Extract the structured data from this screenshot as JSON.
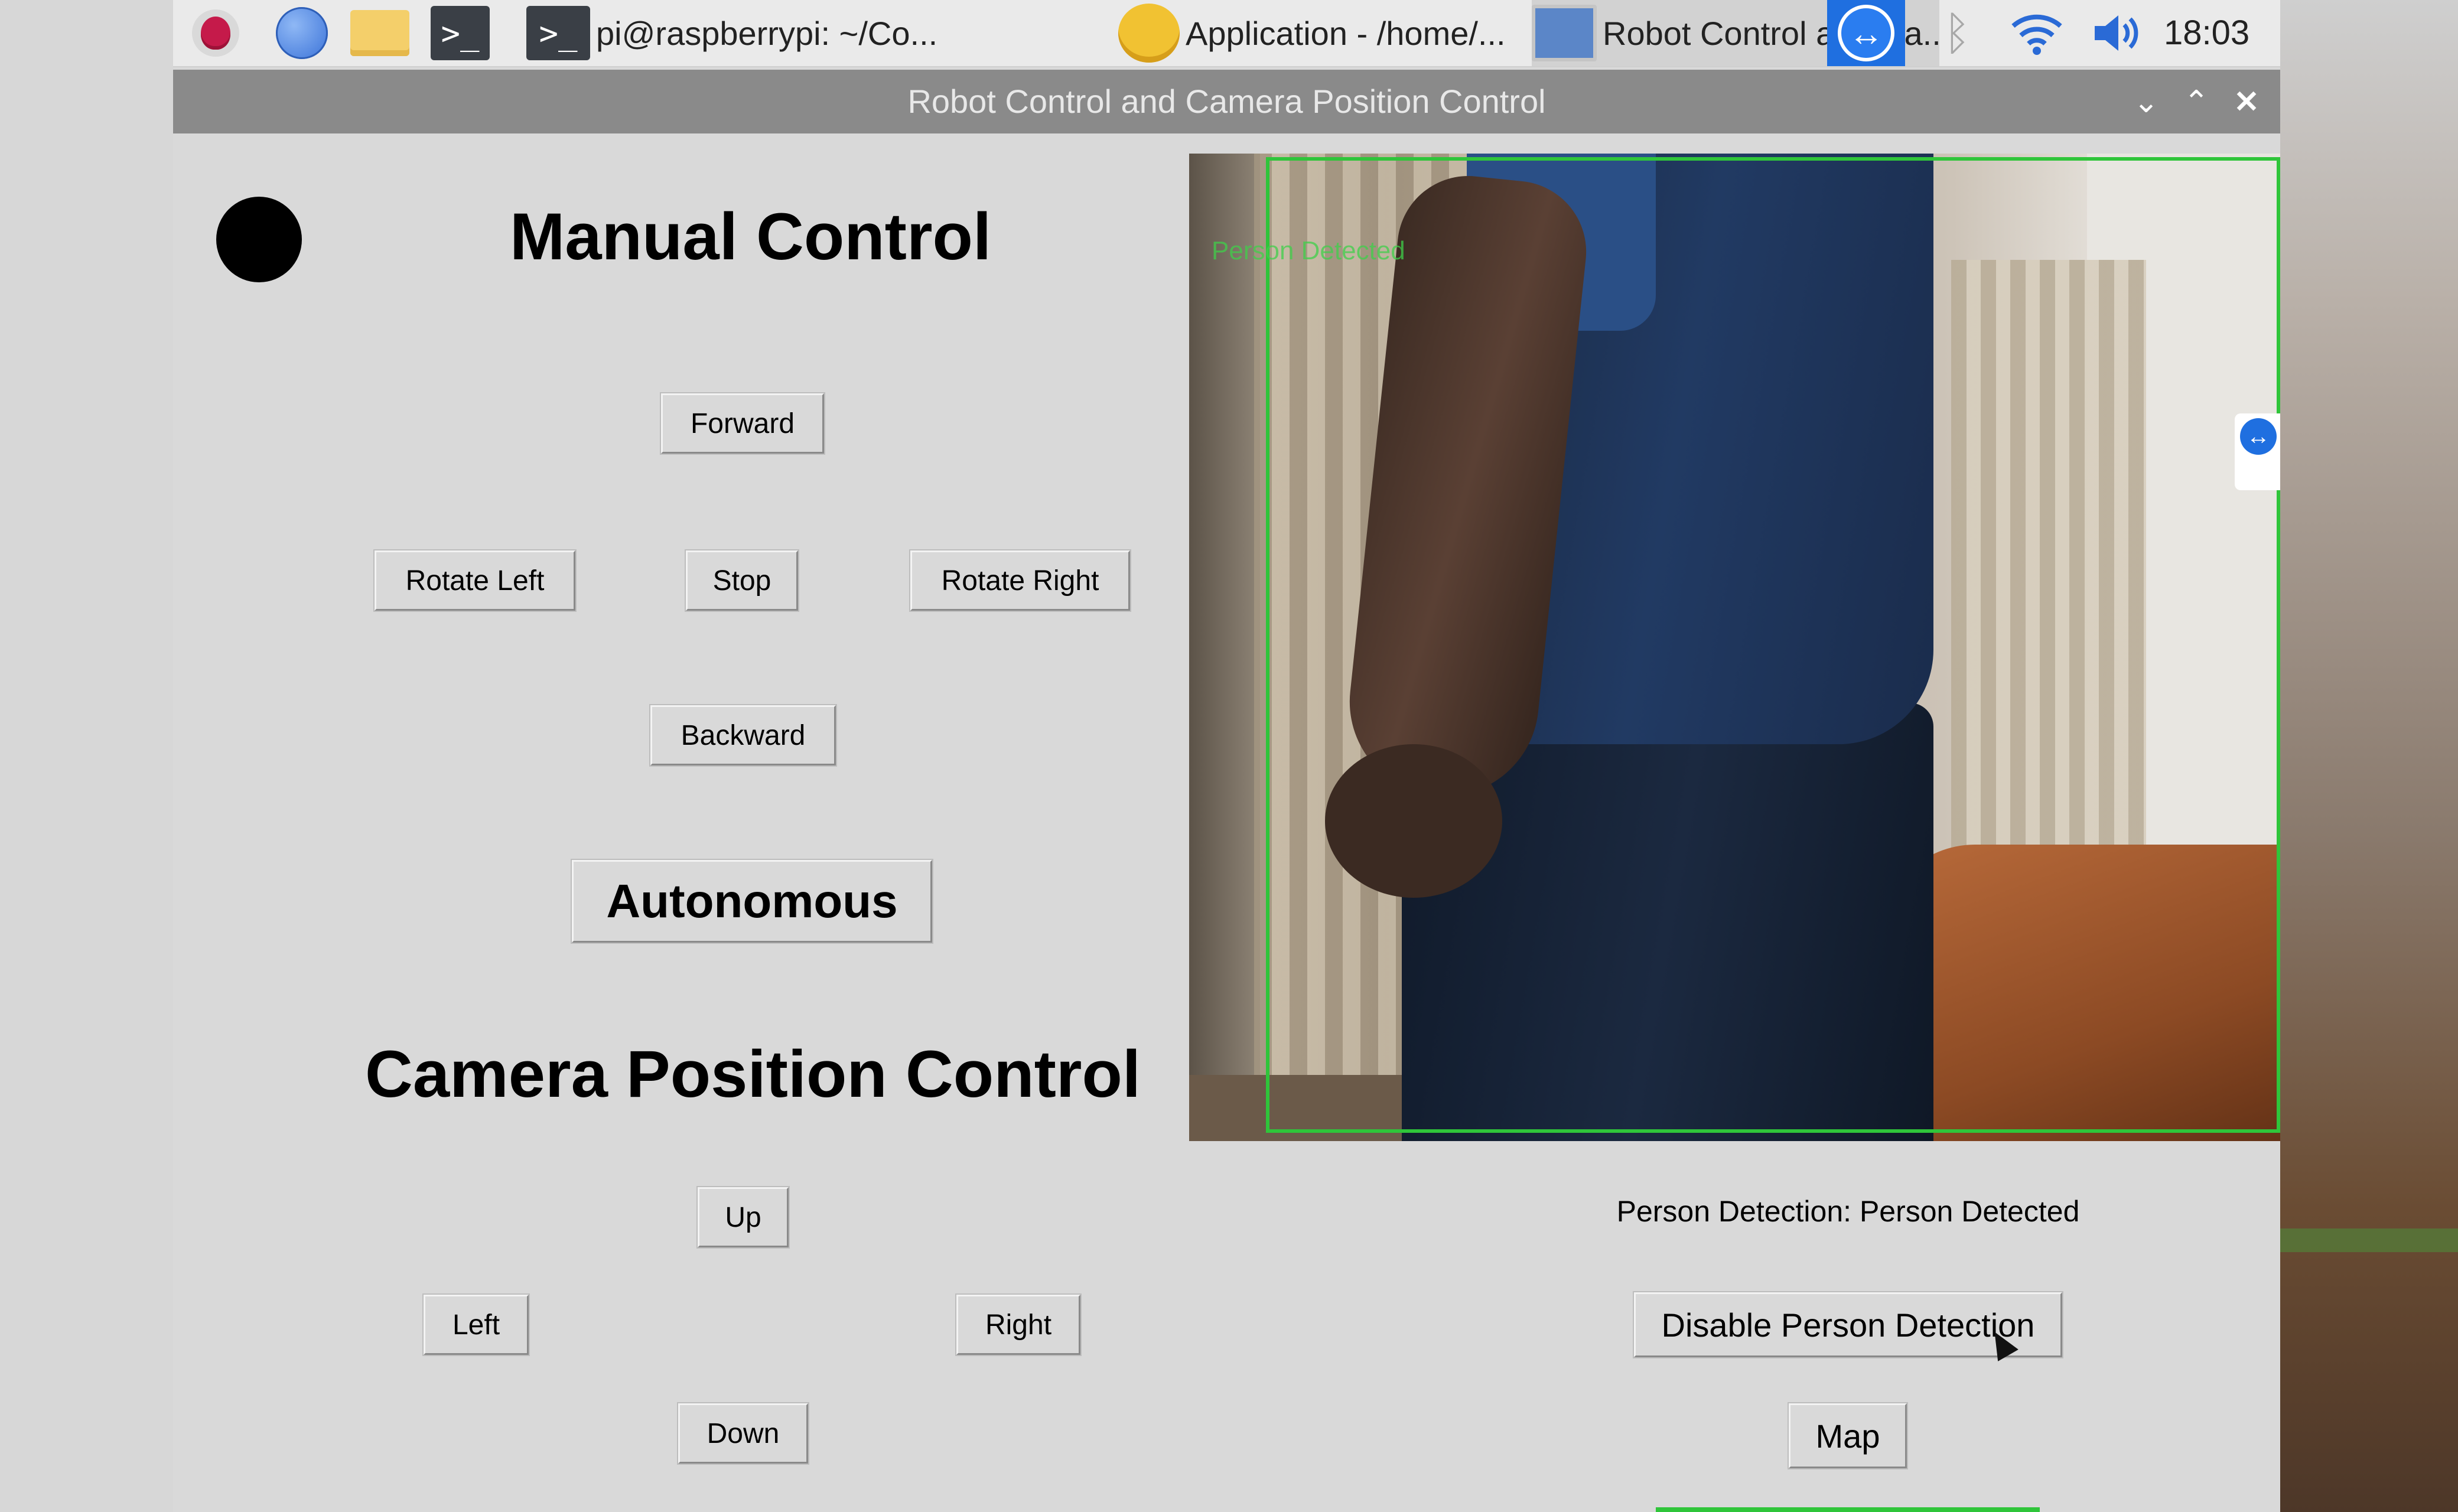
{
  "taskbar": {
    "terminal_prompt_glyph": ">_",
    "task_terminal_label": "pi@raspberrypi: ~/Co...",
    "task_app_label": "Application - /home/...",
    "task_robot_label": "Robot Control and Ca...",
    "clock": "18:03",
    "icons": [
      "raspberry-menu-icon",
      "web-browser-icon",
      "file-manager-icon",
      "terminal-icon",
      "teamviewer-icon",
      "bluetooth-icon",
      "wifi-icon",
      "volume-icon"
    ]
  },
  "window": {
    "title": "Robot Control and Camera Position Control",
    "controls": [
      "minimize",
      "maximize",
      "close"
    ]
  },
  "manual": {
    "heading": "Manual Control",
    "forward": "Forward",
    "rotate_left": "Rotate Left",
    "stop": "Stop",
    "rotate_right": "Rotate Right",
    "backward": "Backward",
    "autonomous": "Autonomous"
  },
  "camera": {
    "heading": "Camera Position Control",
    "up": "Up",
    "left": "Left",
    "right": "Right",
    "down": "Down"
  },
  "feed": {
    "detection_box_label": "Person Detected",
    "detection_box_color": "#2fc53a"
  },
  "detection": {
    "status": "Person Detection: Person Detected",
    "toggle_button": "Disable Person Detection",
    "map_button": "Map"
  },
  "colors": {
    "window_bg": "#d9d9d9",
    "titlebar_bg": "#8a8a8a",
    "indicator": "#000000",
    "teamviewer_blue": "#1f6fe0"
  }
}
